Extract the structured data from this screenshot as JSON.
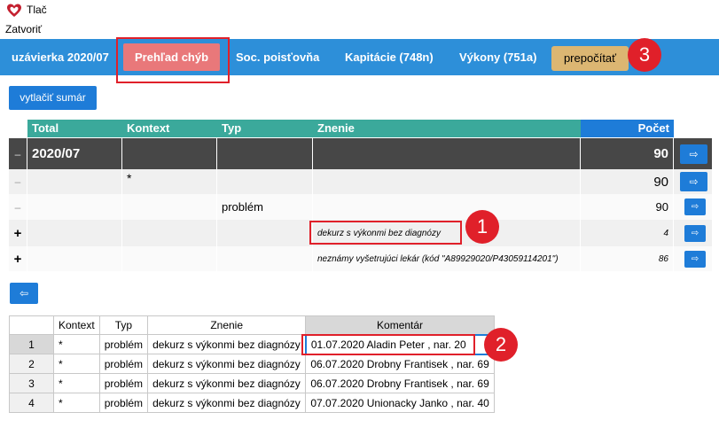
{
  "window": {
    "title": "Tlač"
  },
  "menu": {
    "close_label": "Zatvoriť"
  },
  "tabs": {
    "uzavierka": "uzávierka 2020/07",
    "prehlad": "Prehľad chýb",
    "soc": "Soc. poisťovňa",
    "kapitacie": "Kapitácie (748n)",
    "vykony": "Výkony (751a)"
  },
  "buttons": {
    "recalc": "prepočítať",
    "print_summary": "vytlačiť sumár",
    "back_arrow": "⇦",
    "row_arrow": "⇨"
  },
  "badges": {
    "b1": "1",
    "b2": "2",
    "b3": "3"
  },
  "grid": {
    "headers": {
      "total": "Total",
      "kontext": "Kontext",
      "typ": "Typ",
      "znenie": "Znenie",
      "pocet": "Počet"
    },
    "rows": [
      {
        "toggle": "–",
        "total": "2020/07",
        "kontext": "",
        "typ": "",
        "znenie": "",
        "pocet": "90"
      },
      {
        "toggle": "–",
        "total": "",
        "kontext": "*",
        "typ": "",
        "znenie": "",
        "pocet": "90"
      },
      {
        "toggle": "–",
        "total": "",
        "kontext": "",
        "typ": "problém",
        "znenie": "",
        "pocet": "90"
      },
      {
        "toggle": "+",
        "total": "",
        "kontext": "",
        "typ": "",
        "znenie": "dekurz s výkonmi bez diagnózy",
        "pocet": "4"
      },
      {
        "toggle": "+",
        "total": "",
        "kontext": "",
        "typ": "",
        "znenie": "neznámy vyšetrujúci lekár (kód \"A89929020/P43059114201\")",
        "pocet": "86"
      }
    ]
  },
  "detail": {
    "headers": {
      "kontext": "Kontext",
      "typ": "Typ",
      "znenie": "Znenie",
      "komentar": "Komentár"
    },
    "rows": [
      {
        "n": "1",
        "kontext": "*",
        "typ": "problém",
        "znenie": "dekurz s výkonmi bez diagnózy",
        "komentar": "01.07.2020 Aladin Peter , nar. 20"
      },
      {
        "n": "2",
        "kontext": "*",
        "typ": "problém",
        "znenie": "dekurz s výkonmi bez diagnózy",
        "komentar": "06.07.2020 Drobny Frantisek , nar. 69"
      },
      {
        "n": "3",
        "kontext": "*",
        "typ": "problém",
        "znenie": "dekurz s výkonmi bez diagnózy",
        "komentar": "06.07.2020 Drobny Frantisek , nar. 69"
      },
      {
        "n": "4",
        "kontext": "*",
        "typ": "problém",
        "znenie": "dekurz s výkonmi bez diagnózy",
        "komentar": "07.07.2020 Unionacky Janko , nar. 40"
      }
    ]
  },
  "colors": {
    "accent": "#2d8fd9",
    "active_tab": "#e9787a",
    "recalc": "#dcb672",
    "header_teal": "#3ba99b",
    "highlight": "#e0202a"
  }
}
